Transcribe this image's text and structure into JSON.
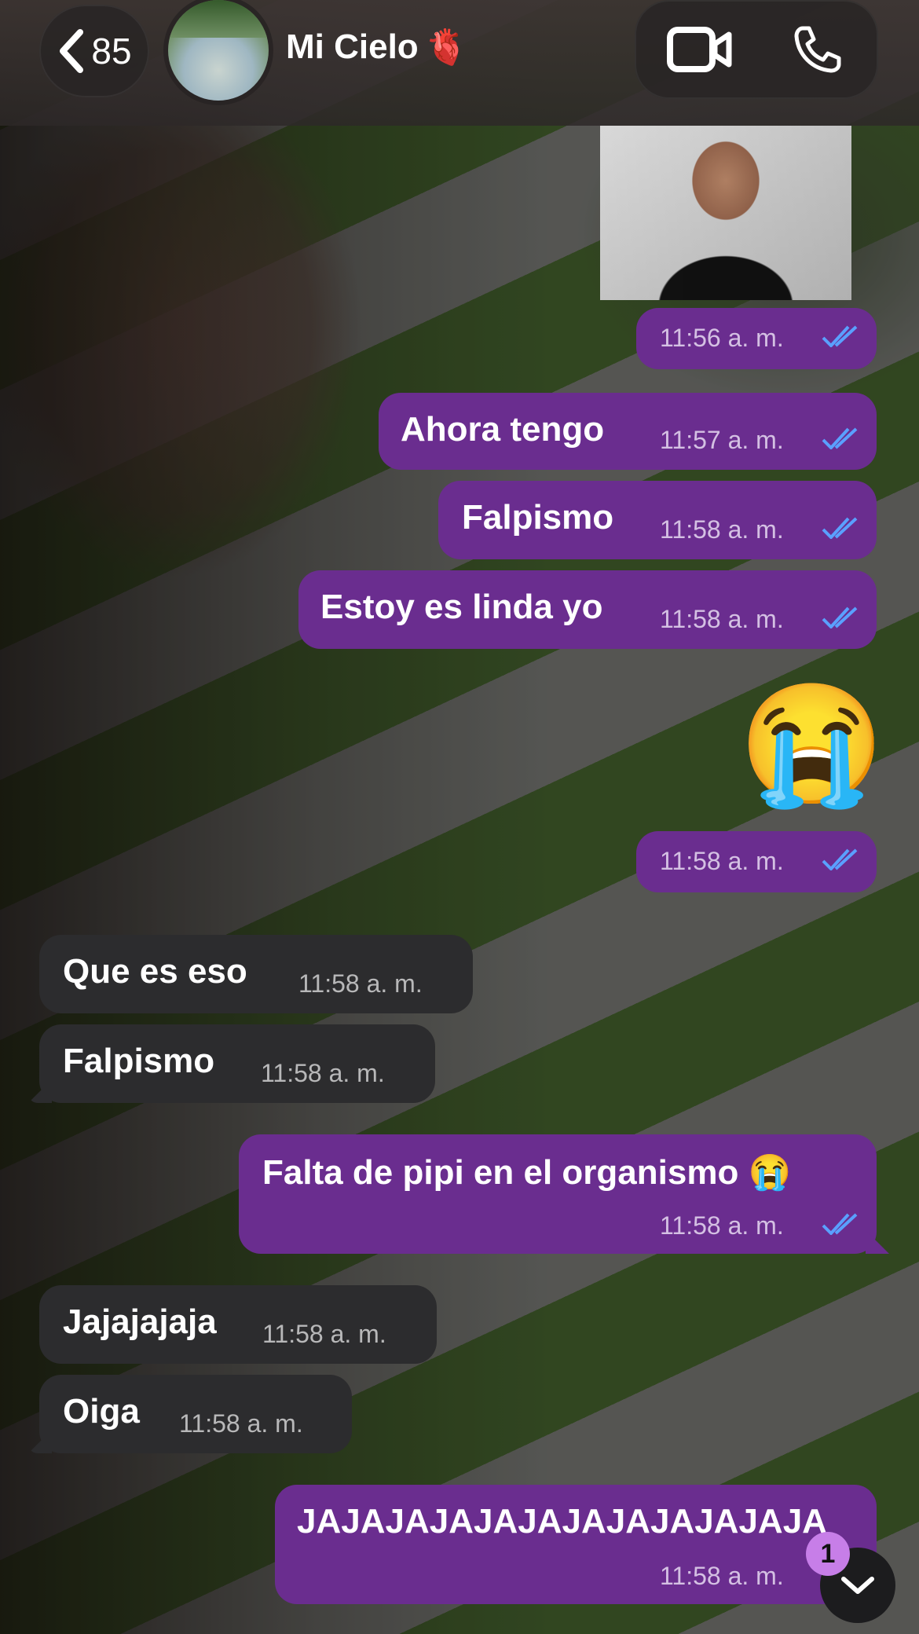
{
  "header": {
    "back_count": "85",
    "contact_name": "Mi Cielo",
    "contact_emoji": "🫀"
  },
  "messages": [
    {
      "direction": "out",
      "type": "media",
      "time": "11:56 a. m.",
      "status": "read"
    },
    {
      "direction": "out",
      "text": "Ahora tengo",
      "time": "11:57 a. m.",
      "status": "read"
    },
    {
      "direction": "out",
      "text": "Falpismo",
      "time": "11:58 a. m.",
      "status": "read"
    },
    {
      "direction": "out",
      "text": "Estoy es linda yo",
      "time": "11:58 a. m.",
      "status": "read"
    },
    {
      "direction": "out",
      "type": "emoji",
      "text": "😭",
      "time": "11:58 a. m.",
      "status": "read"
    },
    {
      "direction": "in",
      "text": "Que es eso",
      "time": "11:58 a. m."
    },
    {
      "direction": "in",
      "text": "Falpismo",
      "time": "11:58 a. m."
    },
    {
      "direction": "out",
      "text": "Falta de pipi en el organismo 😭",
      "time": "11:58 a. m.",
      "status": "read"
    },
    {
      "direction": "in",
      "text": "Jajajajaja",
      "time": "11:58 a. m."
    },
    {
      "direction": "in",
      "text": "Oiga",
      "time": "11:58 a. m."
    },
    {
      "direction": "out",
      "text": "JAJAJAJAJAJAJAJAJAJAJAJA",
      "time": "11:58 a. m.",
      "status": "sent"
    }
  ],
  "scroll_badge": "1",
  "colors": {
    "outgoing_bubble": "#6a2d8f",
    "incoming_bubble": "#2c2c2e",
    "read_ticks": "#5aa0ff",
    "badge": "#c77ee8"
  },
  "icons": {
    "back": "chevron-left-icon",
    "video": "video-camera-icon",
    "phone": "phone-icon",
    "ticks": "double-check-icon",
    "scroll": "chevron-down-icon"
  }
}
